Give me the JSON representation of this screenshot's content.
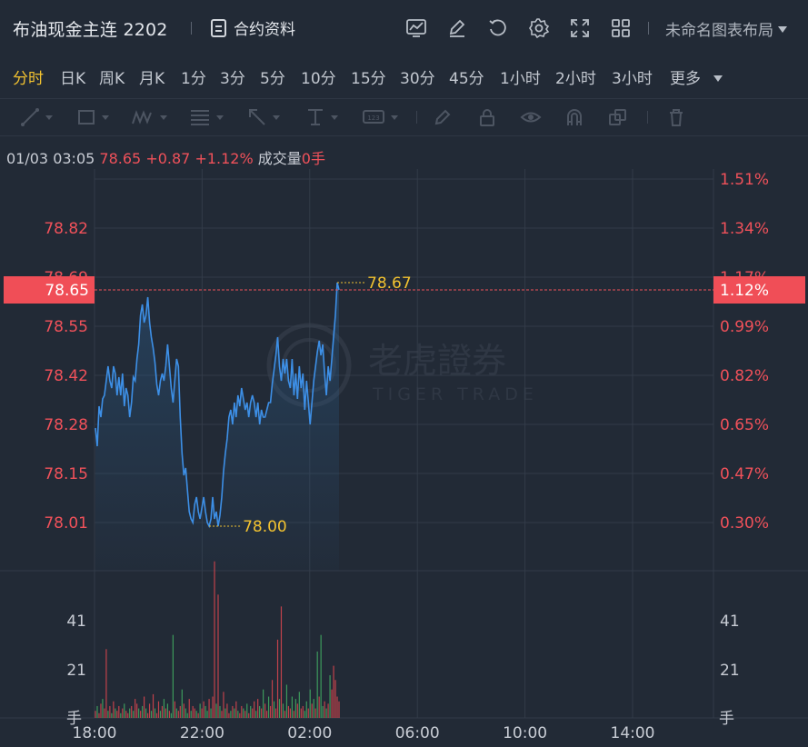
{
  "header": {
    "symbol": "布油现金主连 2202",
    "contract_info_label": "合约资料",
    "layout_label": "未命名图表布局"
  },
  "periods": [
    "分时",
    "日K",
    "周K",
    "月K",
    "1分",
    "3分",
    "5分",
    "10分",
    "15分",
    "30分",
    "45分",
    "1小时",
    "2小时",
    "3小时",
    "更多"
  ],
  "active_period": "分时",
  "info_bar": {
    "datetime": "01/03 03:05",
    "price": "78.65",
    "change": "+0.87",
    "change_pct": "+1.12%",
    "volume_label": "成交量",
    "volume": "0手"
  },
  "watermark": {
    "cn": "老虎證券",
    "en": "TIGER TRADE"
  },
  "colors": {
    "up": "#f0515a",
    "accent": "#f2c230",
    "line": "#3d8fe6",
    "bg": "#222a36"
  },
  "chart_data": {
    "type": "line",
    "title": "",
    "x_ticks": [
      "18:00",
      "22:00",
      "02:00",
      "06:00",
      "10:00",
      "14:00"
    ],
    "price_ticks": [
      "78.82",
      "78.69",
      "78.55",
      "78.42",
      "78.28",
      "78.15",
      "78.01"
    ],
    "pct_ticks": [
      "1.51%",
      "1.34%",
      "1.17%",
      "0.99%",
      "0.82%",
      "0.65%",
      "0.47%",
      "0.30%"
    ],
    "ylim_price": [
      77.95,
      78.95
    ],
    "current_price_label": "78.65",
    "current_pct_label": "1.12%",
    "high_label": "78.67",
    "low_label": "78.00",
    "volume_ticks": [
      "41",
      "21"
    ],
    "volume_unit": "手",
    "series": [
      {
        "values": [
          78.27,
          78.22,
          78.33,
          78.3,
          78.35,
          78.36,
          78.4,
          78.44,
          78.4,
          78.38,
          78.44,
          78.42,
          78.36,
          78.41,
          78.36,
          78.42,
          78.33,
          78.38,
          78.36,
          78.3,
          78.34,
          78.41,
          78.4,
          78.46,
          78.5,
          78.58,
          78.61,
          78.56,
          78.58,
          78.63,
          78.56,
          78.52,
          78.49,
          78.45,
          78.39,
          78.36,
          78.4,
          78.42,
          78.4,
          78.44,
          78.5,
          78.44,
          78.38,
          78.34,
          78.4,
          78.46,
          78.44,
          78.3,
          78.2,
          78.14,
          78.16,
          78.1,
          78.04,
          78.02,
          78.01,
          78.06,
          78.08,
          78.04,
          78.02,
          78.05,
          78.08,
          78.04,
          78.01,
          78.0,
          78.02,
          78.08,
          78.02,
          78.04,
          78.0,
          78.03,
          78.08,
          78.15,
          78.2,
          78.24,
          78.3,
          78.32,
          78.28,
          78.34,
          78.3,
          78.36,
          78.33,
          78.38,
          78.35,
          78.32,
          78.34,
          78.3,
          78.34,
          78.36,
          78.34,
          78.3,
          78.34,
          78.28,
          78.32,
          78.3,
          78.3,
          78.32,
          78.34,
          78.34,
          78.39,
          78.43,
          78.47,
          78.52,
          78.44,
          78.4,
          78.46,
          78.42,
          78.46,
          78.4,
          78.38,
          78.46,
          78.36,
          78.42,
          78.35,
          78.44,
          78.38,
          78.42,
          78.32,
          78.4,
          78.34,
          78.28,
          78.34,
          78.4,
          78.44,
          78.48,
          78.51,
          78.47,
          78.5,
          78.42,
          78.36,
          78.44,
          78.4,
          78.46,
          78.52,
          78.58,
          78.67,
          78.65
        ]
      }
    ],
    "volume_values": [
      3,
      5,
      2,
      6,
      8,
      4,
      29,
      3,
      5,
      2,
      7,
      4,
      3,
      5,
      2,
      4,
      6,
      3,
      2,
      4,
      5,
      3,
      8,
      6,
      4,
      3,
      5,
      9,
      4,
      2,
      6,
      3,
      10,
      4,
      2,
      7,
      3,
      5,
      8,
      4,
      6,
      3,
      2,
      35,
      7,
      4,
      3,
      5,
      12,
      6,
      4,
      2,
      8,
      3,
      5,
      4,
      3,
      2,
      6,
      4,
      7,
      5,
      3,
      8,
      4,
      9,
      66,
      6,
      52,
      5,
      3,
      11,
      4,
      6,
      2,
      3,
      5,
      4,
      7,
      3,
      2,
      5,
      4,
      3,
      6,
      2,
      5,
      4,
      7,
      3,
      8,
      5,
      4,
      12,
      6,
      3,
      9,
      5,
      16,
      7,
      4,
      33,
      8,
      47,
      6,
      3,
      14,
      5,
      4,
      9,
      3,
      8,
      6,
      11,
      4,
      5,
      3,
      7,
      4,
      12,
      6,
      8,
      4,
      28,
      9,
      35,
      5,
      7,
      4,
      6,
      18,
      12,
      22,
      16,
      9,
      7
    ],
    "volume_colors_up": [
      1,
      0,
      1,
      1,
      0,
      1,
      1,
      0,
      1,
      0,
      1,
      0,
      1,
      1,
      0,
      1,
      0,
      1,
      1,
      0,
      1,
      0,
      1,
      1,
      0,
      1,
      0,
      1,
      0,
      1,
      1,
      0,
      1,
      0,
      1,
      1,
      0,
      1,
      0,
      1,
      0,
      1,
      0,
      0,
      1,
      0,
      1,
      1,
      0,
      1,
      0,
      0,
      1,
      0,
      1,
      1,
      0,
      1,
      0,
      1,
      1,
      0,
      0,
      1,
      0,
      1,
      1,
      0,
      1,
      0,
      1,
      1,
      0,
      1,
      1,
      0,
      1,
      0,
      1,
      0,
      1,
      1,
      0,
      1,
      0,
      1,
      0,
      1,
      1,
      0,
      1,
      0,
      1,
      0,
      1,
      1,
      0,
      1,
      1,
      0,
      1,
      1,
      0,
      1,
      0,
      1,
      0,
      1,
      1,
      0,
      1,
      0,
      1,
      0,
      1,
      1,
      0,
      0,
      1,
      0,
      1,
      0,
      1,
      0,
      1,
      0,
      0,
      1,
      0,
      1,
      0,
      1,
      1,
      1,
      1,
      1
    ]
  }
}
